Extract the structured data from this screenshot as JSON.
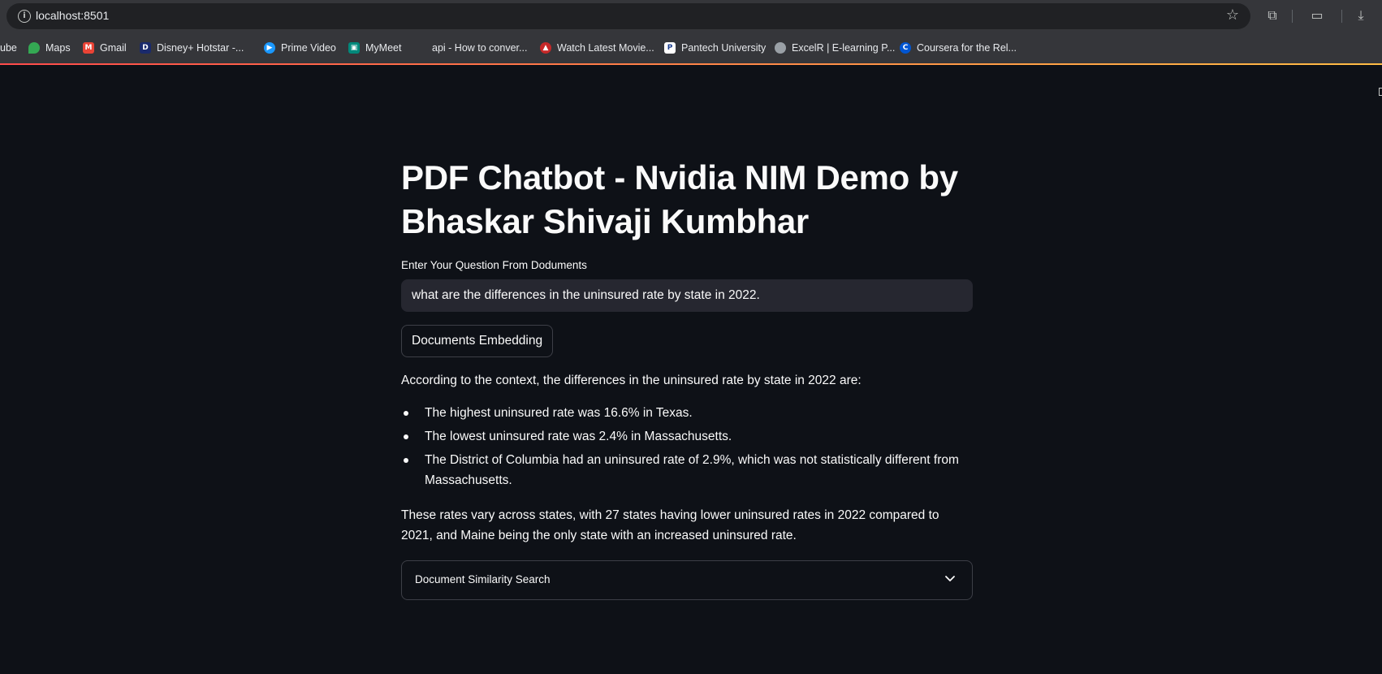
{
  "browser": {
    "url": "localhost:8501",
    "bookmarks": [
      {
        "label": "ube",
        "icon": "youtube-icon"
      },
      {
        "label": "Maps",
        "icon": "maps-icon"
      },
      {
        "label": "Gmail",
        "icon": "gmail-icon"
      },
      {
        "label": "Disney+ Hotstar -...",
        "icon": "hotstar-icon"
      },
      {
        "label": "Prime Video",
        "icon": "prime-video-icon"
      },
      {
        "label": "MyMeet",
        "icon": "meet-icon"
      },
      {
        "label": "api - How to conver...",
        "icon": "stackoverflow-icon"
      },
      {
        "label": "Watch Latest Movie...",
        "icon": "movie-icon"
      },
      {
        "label": "Pantech University",
        "icon": "pantech-icon"
      },
      {
        "label": "ExcelR | E-learning P...",
        "icon": "globe-icon"
      },
      {
        "label": "Coursera for the Rel...",
        "icon": "coursera-icon"
      }
    ]
  },
  "app": {
    "title": "PDF Chatbot - Nvidia NIM Demo by Bhaskar Shivaji Kumbhar",
    "input_label": "Enter Your Question From Doduments",
    "input_value": "what are the differences in the uninsured rate by state in 2022.",
    "button_label": "Documents Embedding",
    "answer_intro": "According to the context, the differences in the uninsured rate by state in 2022 are:",
    "answer_bullets": [
      "The highest uninsured rate was 16.6% in Texas.",
      "The lowest uninsured rate was 2.4% in Massachusetts.",
      "The District of Columbia had an uninsured rate of 2.9%, which was not statistically different from Massachusetts."
    ],
    "answer_outro": "These rates vary across states, with 27 states having lower uninsured rates in 2022 compared to 2021, and Maine being the only state with an increased uninsured rate.",
    "expander_label": "Document Similarity Search"
  },
  "colors": {
    "background": "#0e1117",
    "input_bg": "#262730",
    "chrome_bg": "#35363a",
    "accent_start": "#ff4b4b",
    "accent_end": "#ffbd45"
  }
}
